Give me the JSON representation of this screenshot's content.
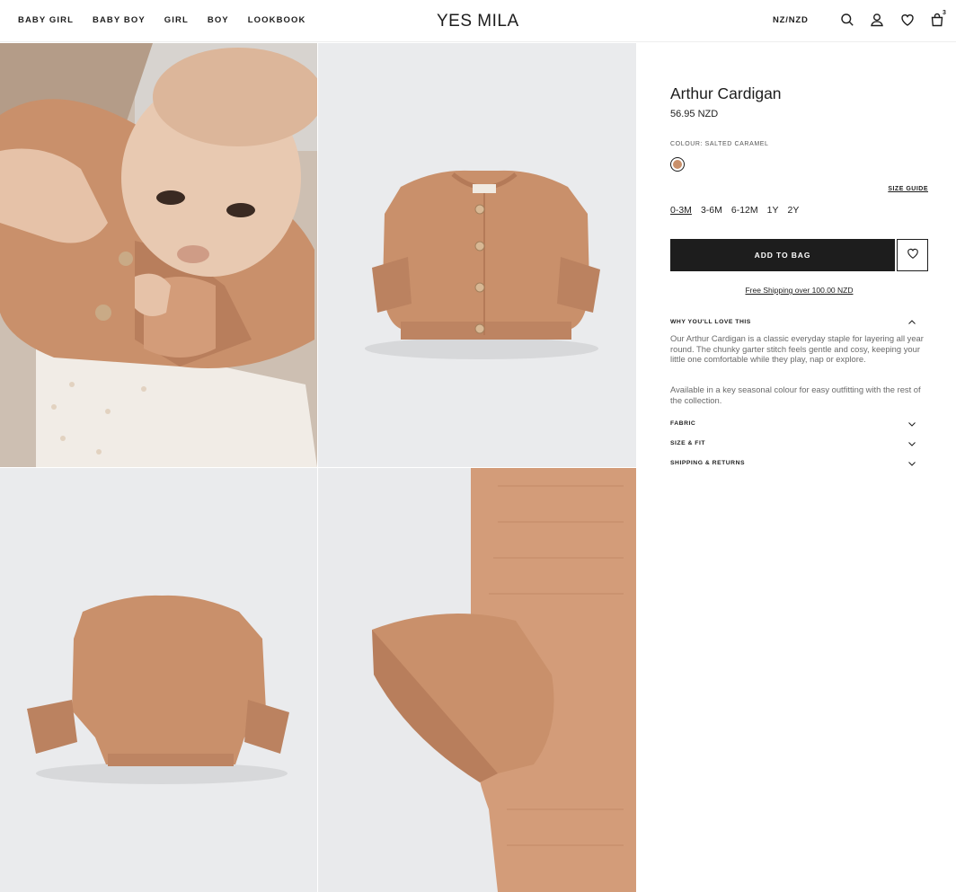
{
  "header": {
    "nav": [
      "BABY GIRL",
      "BABY BOY",
      "GIRL",
      "BOY",
      "LOOKBOOK"
    ],
    "logo": "YES MILA",
    "currency": "NZ/NZD",
    "cart_count": "3",
    "icons": [
      "search-icon",
      "account-icon",
      "heart-icon",
      "bag-icon"
    ]
  },
  "gallery": {
    "images": [
      "baby-wearing-cardigan",
      "cardigan-front",
      "cardigan-back",
      "cardigan-sleeve-detail"
    ]
  },
  "product": {
    "title": "Arthur Cardigan",
    "price": "56.95 NZD",
    "colour_label": "COLOUR: SALTED CARAMEL",
    "swatch_color": "#c9906b",
    "size_guide": "SIZE GUIDE",
    "sizes": [
      "0-3M",
      "3-6M",
      "6-12M",
      "1Y",
      "2Y"
    ],
    "selected_size": "0-3M",
    "add_to_bag": "ADD TO BAG",
    "shipping": "Free Shipping over 100.00 NZD"
  },
  "accordion": {
    "why": {
      "label": "WHY YOU'LL LOVE THIS",
      "paragraphs": [
        "Our Arthur Cardigan is a classic everyday staple for layering all year round. The chunky garter stitch feels gentle and cosy, keeping your little one comfortable while they play, nap or explore.",
        "Available in a key seasonal colour for easy outfitting with the rest of the collection."
      ]
    },
    "fabric": {
      "label": "FABRIC"
    },
    "size_fit": {
      "label": "SIZE & FIT"
    },
    "shipping_returns": {
      "label": "SHIPPING & RETURNS"
    }
  },
  "colors": {
    "knit": "#c9906b",
    "knit_dark": "#a8704f",
    "button_bar": "#1d1d1d"
  }
}
